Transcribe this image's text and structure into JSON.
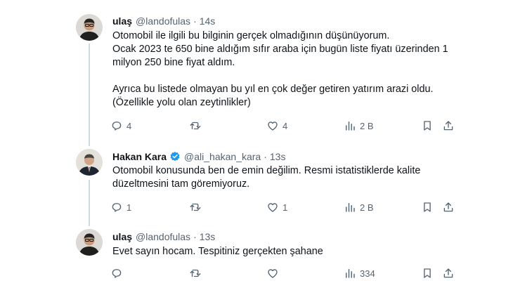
{
  "tweets": [
    {
      "name": "ulaş",
      "handle": "@landofulas",
      "separator": "·",
      "time": "14s",
      "verified": false,
      "text_lines": [
        "Otomobil ile ilgili bu bilginin gerçek olmadığının düşünüyorum.",
        "Ocak 2023 te 650 bine aldığım sıfır araba için bugün liste fiyatı üzerinden 1",
        "milyon 250 bine fiyat aldım.",
        "",
        "Ayrıca bu listede olmayan bu yıl en çok değer getiren yatırım arazi oldu.",
        "(Özellikle yolu olan zeytinlikler)"
      ],
      "replies": "4",
      "retweets": "",
      "likes": "4",
      "views": "2 B"
    },
    {
      "name": "Hakan Kara",
      "handle": "@ali_hakan_kara",
      "separator": "·",
      "time": "13s",
      "verified": true,
      "text_lines": [
        "Otomobil konusunda ben de emin değilim. Resmi istatistiklerde kalite",
        "düzeltmesini tam göremiyoruz."
      ],
      "replies": "1",
      "retweets": "",
      "likes": "1",
      "views": "2 B"
    },
    {
      "name": "ulaş",
      "handle": "@landofulas",
      "separator": "·",
      "time": "13s",
      "verified": false,
      "text_lines": [
        "Evet sayın hocam. Tespitiniz gerçekten şahane"
      ],
      "replies": "",
      "retweets": "",
      "likes": "",
      "views": "334"
    }
  ],
  "colors": {
    "text": "#0f1419",
    "secondary": "#536471",
    "verified": "#1d9bf0",
    "thread_line": "#cfd9de"
  },
  "icons": [
    "reply-icon",
    "retweet-icon",
    "like-icon",
    "views-icon",
    "bookmark-icon",
    "share-icon",
    "verified-badge-icon"
  ]
}
